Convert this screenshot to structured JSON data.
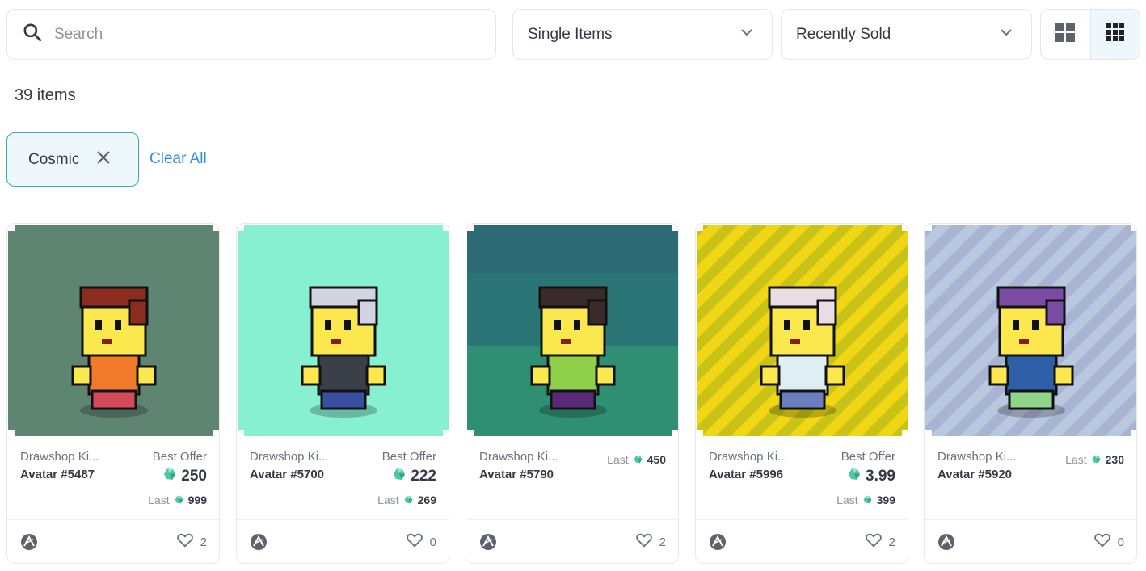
{
  "search": {
    "placeholder": "Search"
  },
  "filters": {
    "item_type": "Single Items",
    "sort": "Recently Sold",
    "view_icons": [
      "grid-large-icon",
      "grid-small-icon"
    ]
  },
  "results": {
    "count_text": "39 items"
  },
  "active_filters": {
    "chips": [
      "Cosmic"
    ],
    "clear_label": "Clear All"
  },
  "colors": {
    "accent": "#2f8fdf",
    "gem": "#4fc7a3",
    "chip_border": "#3aa7c8"
  },
  "cards": [
    {
      "collection": "Drawshop Ki...",
      "name": "Avatar #5487",
      "best_label": "Best Offer",
      "best_price": "250",
      "last_label": "Last",
      "last_price": "999",
      "likes": "2",
      "bg": "#5e8472"
    },
    {
      "collection": "Drawshop Ki...",
      "name": "Avatar #5700",
      "best_label": "Best Offer",
      "best_price": "222",
      "last_label": "Last",
      "last_price": "269",
      "likes": "0",
      "bg": "#86f0d0"
    },
    {
      "collection": "Drawshop Ki...",
      "name": "Avatar #5790",
      "best_label": "",
      "best_price": "",
      "last_label": "Last",
      "last_price": "450",
      "likes": "2",
      "bg": "#2c6b74"
    },
    {
      "collection": "Drawshop Ki...",
      "name": "Avatar #5996",
      "best_label": "Best Offer",
      "best_price": "3.99",
      "last_label": "Last",
      "last_price": "399",
      "likes": "2",
      "bg": "#f1d616"
    },
    {
      "collection": "Drawshop Ki...",
      "name": "Avatar #5920",
      "best_label": "",
      "best_price": "",
      "last_label": "Last",
      "last_price": "230",
      "likes": "0",
      "bg": "#b8c8de"
    }
  ]
}
